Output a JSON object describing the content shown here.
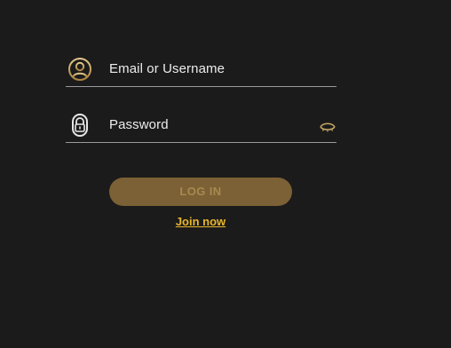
{
  "login_form": {
    "email": {
      "placeholder": "Email or Username",
      "icon": "user-circle-icon"
    },
    "password": {
      "placeholder": "Password",
      "icon": "lock-icon",
      "toggle_icon": "eye-closed-icon"
    },
    "login_button_label": "LOG IN",
    "join_link_label": "Join now"
  },
  "colors": {
    "background": "#1c1b1b",
    "gold": "#c5a666",
    "button_fill": "#7b6135",
    "link": "#e6b62c",
    "underline": "#9b9b9b"
  }
}
